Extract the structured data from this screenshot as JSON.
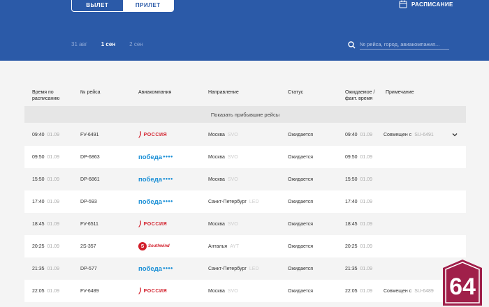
{
  "tabs": {
    "departure": "ВЫЛЕТ",
    "arrival": "ПРИЛЕТ"
  },
  "schedule_label": "РАСПИСАНИЕ",
  "dates": [
    "31 авг",
    "1 сен",
    "2 сен"
  ],
  "search": {
    "placeholder": "№ рейса, город, авиакомпания..."
  },
  "columns": {
    "sched_time": "Время по расписанию",
    "flight": "№ рейса",
    "airline": "Авиакомпания",
    "direction": "Направление",
    "status": "Статус",
    "expected": "Ожидаемое / факт. время",
    "note": "Примечание"
  },
  "show_arrived": "Показать прибывшие рейсы",
  "flights": [
    {
      "time": "09:40",
      "date": "01.09",
      "flight": "FV-6491",
      "airline": "rossiya",
      "city": "Москва",
      "code": "SVO",
      "status": "Ожидается",
      "exp_time": "09:40",
      "exp_date": "01.09",
      "note": "Совмещен с",
      "note_code": "SU-6491"
    },
    {
      "time": "09:50",
      "date": "01.09",
      "flight": "DP-6863",
      "airline": "pobeda",
      "city": "Москва",
      "code": "SVO",
      "status": "Ожидается",
      "exp_time": "09:50",
      "exp_date": "01.09",
      "note": "",
      "note_code": ""
    },
    {
      "time": "15:50",
      "date": "01.09",
      "flight": "DP-6861",
      "airline": "pobeda",
      "city": "Москва",
      "code": "SVO",
      "status": "Ожидается",
      "exp_time": "15:50",
      "exp_date": "01.09",
      "note": "",
      "note_code": ""
    },
    {
      "time": "17:40",
      "date": "01.09",
      "flight": "DP-593",
      "airline": "pobeda",
      "city": "Санкт-Петербург",
      "code": "LED",
      "status": "Ожидается",
      "exp_time": "17:40",
      "exp_date": "01.09",
      "note": "",
      "note_code": ""
    },
    {
      "time": "18:45",
      "date": "01.09",
      "flight": "FV-6511",
      "airline": "rossiya",
      "city": "Москва",
      "code": "SVO",
      "status": "Ожидается",
      "exp_time": "18:45",
      "exp_date": "01.09",
      "note": "",
      "note_code": ""
    },
    {
      "time": "20:25",
      "date": "01.09",
      "flight": "2S-357",
      "airline": "southwind",
      "city": "Анталья",
      "code": "AYT",
      "status": "Ожидается",
      "exp_time": "20:25",
      "exp_date": "01.09",
      "note": "",
      "note_code": ""
    },
    {
      "time": "21:35",
      "date": "01.09",
      "flight": "DP-577",
      "airline": "pobeda",
      "city": "Санкт-Петербург",
      "code": "LED",
      "status": "Ожидается",
      "exp_time": "21:35",
      "exp_date": "01.09",
      "note": "",
      "note_code": ""
    },
    {
      "time": "22:05",
      "date": "01.09",
      "flight": "FV-6489",
      "airline": "rossiya",
      "city": "Москва",
      "code": "SVO",
      "status": "Ожидается",
      "exp_time": "22:05",
      "exp_date": "01.09",
      "note": "Совмещен с",
      "note_code": "SU-6489"
    }
  ],
  "logos": {
    "rossiya": "РОССИЯ",
    "pobeda": "победа",
    "southwind": "Southwind"
  },
  "badge": "64",
  "colors": {
    "header": "#2b5aa8",
    "rossiya": "#d21f2b",
    "pobeda": "#1a8fd6",
    "badge": "#a0204a"
  }
}
